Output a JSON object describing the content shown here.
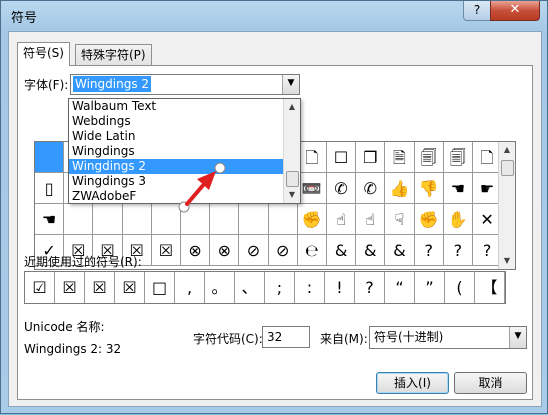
{
  "window": {
    "title": "符号",
    "help_label": "?",
    "close_label": "✕"
  },
  "tabs": [
    {
      "label": "符号(S)"
    },
    {
      "label": "特殊字符(P)"
    }
  ],
  "font_field": {
    "label": "字体(F):",
    "value": "Wingdings 2"
  },
  "font_dropdown": {
    "items": [
      "Walbaum Text",
      "Webdings",
      "Wide Latin",
      "Wingdings",
      "Wingdings 2",
      "Wingdings 3",
      "ZWAdobeF"
    ],
    "selected": "Wingdings 2"
  },
  "symbol_grid": {
    "row1": [
      "",
      "✎",
      "",
      "",
      "",
      "",
      "",
      "",
      "",
      "🗋",
      "☐",
      "❐",
      "🗎",
      "🗐",
      "🗐",
      "🗋"
    ],
    "row2": [
      "▯",
      "",
      "",
      "",
      "",
      "",
      "",
      "",
      "",
      "📼",
      "✆",
      "✆",
      "👍",
      "👎",
      "☚",
      "☛"
    ],
    "row3": [
      "☚",
      "",
      "",
      "",
      "",
      "",
      "",
      "",
      "",
      "✊",
      "☝",
      "☝",
      "☟",
      "✊",
      "✋",
      "✕"
    ],
    "row4": [
      "✓",
      "☒",
      "☒",
      "☒",
      "☒",
      "⊗",
      "⊗",
      "⊘",
      "⊘",
      "℮",
      "&",
      "&",
      "&",
      "?",
      "?",
      "?"
    ]
  },
  "recent": {
    "label": "近期使用过的符号(R):",
    "symbols": [
      "☑",
      "☒",
      "☒",
      "☒",
      "□",
      ",",
      "。",
      "、",
      ";",
      ":",
      "!",
      "?",
      "“",
      "”",
      "(",
      "【"
    ]
  },
  "unicode": {
    "label": "Unicode 名称:",
    "name": "Wingdings 2: 32"
  },
  "char_code": {
    "label": "字符代码(C):",
    "value": "32"
  },
  "from": {
    "label": "来自(M):",
    "value": "符号(十进制)"
  },
  "buttons": {
    "insert": "插入(I)",
    "cancel": "取消"
  },
  "colors": {
    "selection": "#3399ff",
    "arrow": "#e02020"
  }
}
